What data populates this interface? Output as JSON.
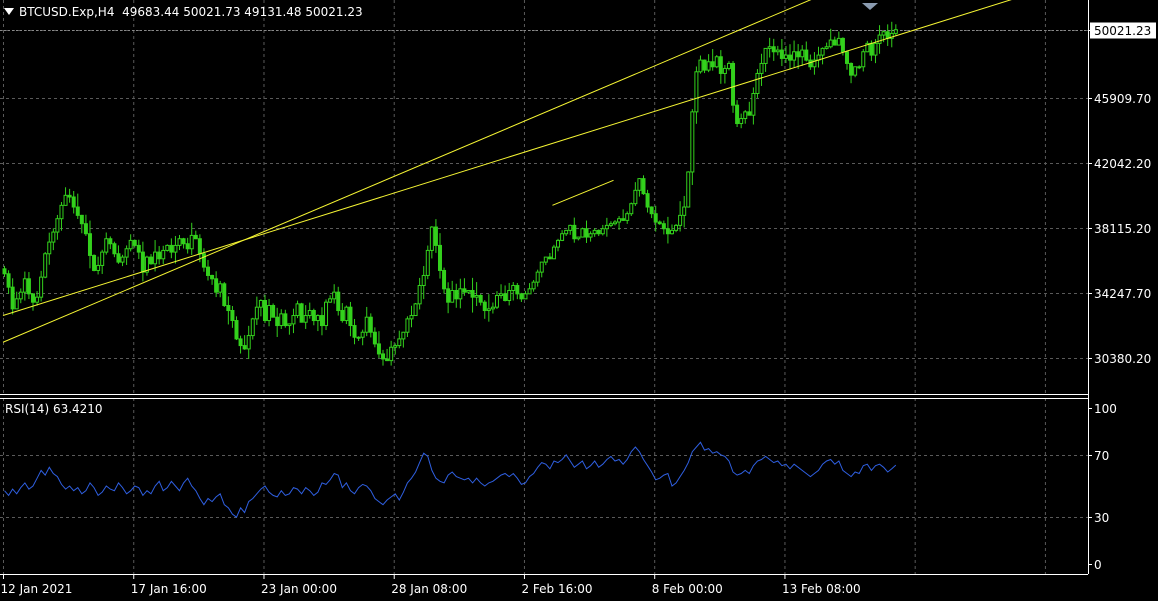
{
  "header": {
    "symbol": "BTCUSD.Exp,H4",
    "open": "49683.44",
    "high": "50021.73",
    "low": "49131.48",
    "close": "50021.23"
  },
  "rsi_header": {
    "label": "RSI(14) 63.4210"
  },
  "colors": {
    "background": "#000000",
    "candle": "#33d11c",
    "rsi_line": "#2f5fe0",
    "channel": "#f5f533",
    "grid": "#5a5a5a",
    "axis": "#ffffff"
  },
  "chart_data": [
    {
      "type": "candlestick",
      "ylim": [
        28200,
        51800
      ],
      "yticks": [
        "50021.23",
        "45909.70",
        "42042.20",
        "38115.20",
        "34247.70",
        "30380.20"
      ],
      "yticks_values": [
        50021.23,
        45909.7,
        42042.2,
        38115.2,
        34247.7,
        30380.2
      ],
      "last_price": "50021.23",
      "xticks": [
        "12 Jan 2021",
        "17 Jan 16:00",
        "23 Jan 00:00",
        "28 Jan 08:00",
        "2 Feb 16:00",
        "8 Feb 00:00",
        "13 Feb 08:00"
      ],
      "grid": true,
      "close_series": [
        35400,
        34600,
        33300,
        33900,
        34300,
        35100,
        34200,
        33700,
        34000,
        35200,
        36600,
        37300,
        37900,
        38700,
        39500,
        40100,
        40000,
        39400,
        38900,
        38400,
        37800,
        36500,
        35600,
        35900,
        36700,
        37500,
        37200,
        36600,
        36100,
        36400,
        36900,
        37400,
        37100,
        36700,
        35500,
        36400,
        36000,
        36700,
        36300,
        36800,
        37100,
        36700,
        37100,
        37500,
        37200,
        36900,
        37700,
        37500,
        36600,
        35800,
        35300,
        35100,
        34300,
        34800,
        33500,
        33200,
        32600,
        31500,
        31100,
        30900,
        31700,
        32700,
        33400,
        33800,
        32600,
        33500,
        32800,
        32300,
        33000,
        32300,
        32400,
        32900,
        33600,
        32500,
        32900,
        33200,
        32600,
        32900,
        32300,
        33700,
        33900,
        34300,
        33200,
        32600,
        33400,
        32300,
        31600,
        31600,
        31900,
        32800,
        31900,
        31200,
        30600,
        30300,
        30200,
        31000,
        31100,
        31500,
        31900,
        32700,
        32900,
        33600,
        34700,
        35300,
        36800,
        38200,
        37100,
        35600,
        34500,
        33700,
        34400,
        33900,
        34500,
        34300,
        34400,
        34000,
        34100,
        33700,
        33200,
        33300,
        33400,
        34100,
        34200,
        33800,
        34400,
        34700,
        34200,
        33900,
        34200,
        34500,
        34900,
        35500,
        36100,
        36400,
        36300,
        37000,
        37400,
        37800,
        38000,
        38300,
        37500,
        37600,
        38100,
        37600,
        37800,
        38000,
        37800,
        38100,
        38300,
        38400,
        38500,
        38700,
        38600,
        39000,
        39600,
        40400,
        41100,
        40200,
        39400,
        39000,
        38500,
        38400,
        38100,
        37800,
        38000,
        38300,
        38900,
        39400,
        41500,
        45100,
        47500,
        48200,
        47600,
        48100,
        47800,
        48400,
        47400,
        47700,
        48000,
        45500,
        44400,
        44700,
        45100,
        44900,
        46200,
        47400,
        48000,
        48900,
        49000,
        48700,
        48800,
        48300,
        48500,
        48200,
        48700,
        48400,
        48800,
        48200,
        47800,
        48200,
        48500,
        48900,
        49000,
        49400,
        49100,
        49500,
        48700,
        48000,
        47300,
        47800,
        47800,
        48700,
        49200,
        48500,
        49200,
        49700,
        49900,
        49500,
        49800,
        50021.23
      ],
      "channel_lines": [
        {
          "from": [
            0,
            31300
          ],
          "to": [
            207,
            52700
          ]
        },
        {
          "from": [
            0,
            32900
          ],
          "to": [
            254,
            52300
          ]
        },
        {
          "from": [
            135,
            39500
          ],
          "to": [
            150,
            41000
          ]
        }
      ]
    },
    {
      "type": "line",
      "name": "RSI(14)",
      "ylim": [
        0,
        100
      ],
      "yticks": [
        "100",
        "70",
        "30",
        "0"
      ],
      "yticks_values": [
        100,
        70,
        30,
        0
      ],
      "xticks": [
        "12 Jan 2021",
        "17 Jan 16:00",
        "23 Jan 00:00",
        "28 Jan 08:00",
        "2 Feb 16:00",
        "8 Feb 00:00",
        "13 Feb 08:00"
      ],
      "grid": true,
      "values": [
        47,
        44,
        48,
        45,
        49,
        52,
        48,
        50,
        55,
        60,
        57,
        62,
        58,
        56,
        51,
        48,
        50,
        47,
        49,
        45,
        47,
        52,
        49,
        44,
        46,
        50,
        48,
        47,
        52,
        49,
        45,
        47,
        50,
        49,
        44,
        47,
        45,
        50,
        53,
        47,
        49,
        53,
        50,
        47,
        52,
        55,
        50,
        47,
        42,
        38,
        42,
        40,
        43,
        45,
        38,
        36,
        32,
        30,
        36,
        33,
        40,
        42,
        45,
        48,
        50,
        46,
        44,
        43,
        47,
        44,
        45,
        49,
        48,
        45,
        49,
        47,
        44,
        46,
        52,
        51,
        54,
        58,
        57,
        49,
        52,
        47,
        45,
        49,
        51,
        50,
        47,
        42,
        40,
        38,
        41,
        43,
        45,
        41,
        46,
        52,
        55,
        59,
        65,
        71,
        69,
        60,
        55,
        53,
        52,
        57,
        59,
        56,
        55,
        54,
        55,
        52,
        55,
        52,
        50,
        52,
        53,
        55,
        57,
        58,
        56,
        58,
        55,
        51,
        52,
        56,
        58,
        62,
        65,
        64,
        61,
        66,
        65,
        67,
        70,
        66,
        62,
        64,
        66,
        61,
        63,
        66,
        62,
        64,
        67,
        69,
        66,
        67,
        64,
        67,
        72,
        75,
        72,
        67,
        63,
        59,
        54,
        55,
        57,
        58,
        50,
        52,
        56,
        60,
        65,
        72,
        75,
        78,
        73,
        74,
        71,
        72,
        70,
        69,
        66,
        59,
        57,
        58,
        60,
        58,
        63,
        66,
        67,
        69,
        67,
        65,
        66,
        63,
        64,
        61,
        64,
        62,
        60,
        58,
        56,
        58,
        60,
        64,
        66,
        67,
        64,
        66,
        60,
        58,
        56,
        59,
        58,
        63,
        64,
        60,
        63,
        64,
        62,
        59,
        61,
        63.42
      ]
    }
  ]
}
